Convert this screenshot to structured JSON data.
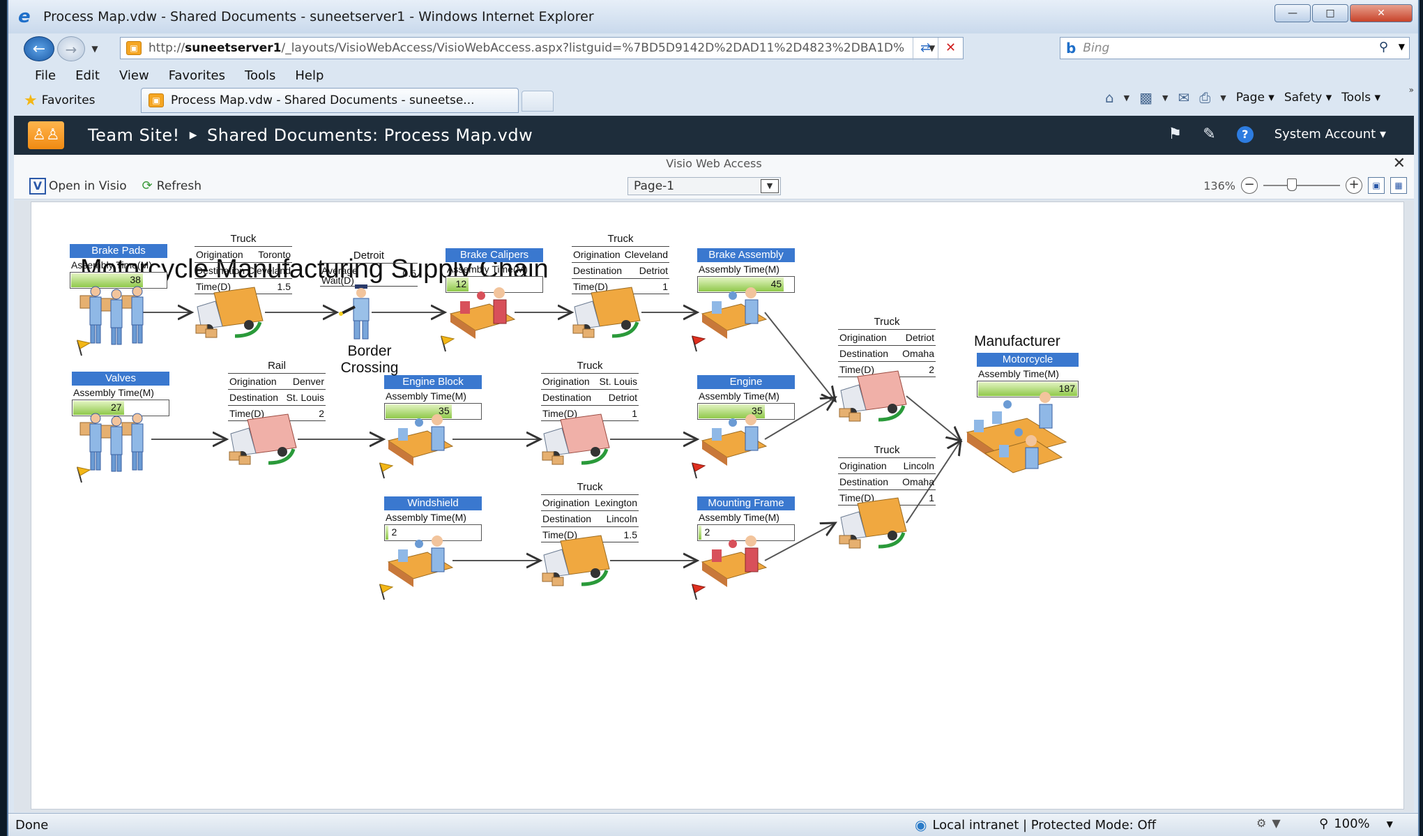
{
  "browser": {
    "title": "Process Map.vdw - Shared Documents - suneetserver1 - Windows Internet Explorer",
    "url_prefix": "http://",
    "url_host": "suneetserver1",
    "url_path": "/_layouts/VisioWebAccess/VisioWebAccess.aspx?listguid=%7BD5D9142D%2DAD11%2D4823%2DBA1D%",
    "search_placeholder": "Bing",
    "menu": [
      "File",
      "Edit",
      "View",
      "Favorites",
      "Tools",
      "Help"
    ],
    "favorites_label": "Favorites",
    "tab_title": "Process Map.vdw - Shared Documents - suneetse...",
    "commands": {
      "page": "Page",
      "safety": "Safety",
      "tools": "Tools"
    }
  },
  "sharepoint": {
    "site": "Team Site!",
    "location": "Shared Documents: Process Map.vdw",
    "account": "System Account"
  },
  "visio": {
    "header": "Visio Web Access",
    "open_label": "Open in Visio",
    "refresh_label": "Refresh",
    "page_select": "Page-1",
    "zoom": "136%"
  },
  "diagram": {
    "title": "Motorcycle Manufacturing Supply Chain",
    "processes": {
      "brake_pads": {
        "name": "Brake Pads",
        "label": "Assembly Time(M)",
        "value": "38",
        "fraction": 0.76
      },
      "valves": {
        "name": "Valves",
        "label": "Assembly Time(M)",
        "value": "27",
        "fraction": 0.54
      },
      "brake_calipers": {
        "name": "Brake Calipers",
        "label": "Assembly Time(M)",
        "value": "12",
        "fraction": 0.24
      },
      "engine_block": {
        "name": "Engine Block",
        "label": "Assembly Time(M)",
        "value": "35",
        "fraction": 0.7
      },
      "windshield": {
        "name": "Windshield",
        "label": "Assembly Time(M)",
        "value": "2",
        "fraction": 0.04
      },
      "brake_assembly": {
        "name": "Brake Assembly",
        "label": "Assembly Time(M)",
        "value": "45",
        "fraction": 0.9
      },
      "engine": {
        "name": "Engine",
        "label": "Assembly Time(M)",
        "value": "35",
        "fraction": 0.7
      },
      "mounting_frame": {
        "name": "Mounting Frame",
        "label": "Assembly Time(M)",
        "value": "2",
        "fraction": 0.04
      },
      "motorcycle": {
        "name": "Motorcycle",
        "label": "Assembly Time(M)",
        "value": "187",
        "fraction": 1.0
      }
    },
    "shipments": {
      "truck_toronto": {
        "title": "Truck",
        "origination": "Toronto",
        "destination": "Cleveland",
        "time": "1.5"
      },
      "truck_cleveland": {
        "title": "Truck",
        "origination": "Cleveland",
        "destination": "Detriot",
        "time": "1"
      },
      "rail_denver": {
        "title": "Rail",
        "origination": "Denver",
        "destination": "St. Louis",
        "time": "2"
      },
      "truck_stlouis": {
        "title": "Truck",
        "origination": "St. Louis",
        "destination": "Detriot",
        "time": "1"
      },
      "truck_lexington": {
        "title": "Truck",
        "origination": "Lexington",
        "destination": "Lincoln",
        "time": "1.5"
      },
      "truck_detriot": {
        "title": "Truck",
        "origination": "Detriot",
        "destination": "Omaha",
        "time": "2"
      },
      "truck_lincoln": {
        "title": "Truck",
        "origination": "Lincoln",
        "destination": "Omaha",
        "time": "1"
      }
    },
    "row_labels": {
      "origination": "Origination",
      "destination": "Destination",
      "time": "Time(D)"
    },
    "border": {
      "title": "Detroit",
      "wait_label_1": "Average",
      "wait_label_2": "Wait(D)",
      "wait_value": "0.5",
      "caption_1": "Border",
      "caption_2": "Crossing"
    },
    "manufacturer": "Manufacturer"
  },
  "status": {
    "left": "Done",
    "zone": "Local intranet | Protected Mode: Off",
    "zoom": "100%"
  }
}
